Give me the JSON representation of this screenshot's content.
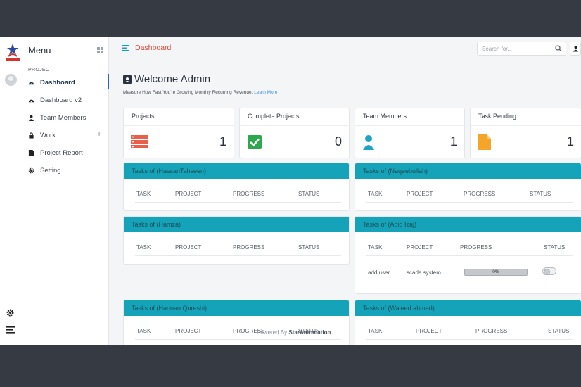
{
  "sidebar": {
    "menu_title": "Menu",
    "section_label": "PROJECT",
    "items": [
      {
        "label": "Dashboard",
        "icon": "dashboard-icon"
      },
      {
        "label": "Dashboard v2",
        "icon": "dashboard-icon"
      },
      {
        "label": "Team Members",
        "icon": "user-icon"
      },
      {
        "label": "Work",
        "icon": "lock-icon",
        "expand": "+"
      },
      {
        "label": "Project Report",
        "icon": "report-icon"
      },
      {
        "label": "Setting",
        "icon": "gear-icon"
      }
    ]
  },
  "topbar": {
    "title": "Dashboard",
    "search_placeholder": "Search for..."
  },
  "main": {
    "welcome": "Welcome Admin",
    "subtitle": "Measure How Fast You're Growing Monthly Recurring Revenue.",
    "learn_more": "Learn More"
  },
  "stats": [
    {
      "label": "Projects",
      "value": "1",
      "icon": "server-icon",
      "color": "#e8604c"
    },
    {
      "label": "Complete Projects",
      "value": "0",
      "icon": "check-icon",
      "color": "#2ea84f"
    },
    {
      "label": "Team Members",
      "value": "1",
      "icon": "user-icon",
      "color": "#1ba7c4"
    },
    {
      "label": "Task Pending",
      "value": "1",
      "icon": "file-icon",
      "color": "#f4a52a"
    }
  ],
  "task_columns": [
    "TASK",
    "PROJECT",
    "PROGRESS",
    "STATUS"
  ],
  "task_cards": [
    {
      "title": "Tasks of (HassanTahseen)"
    },
    {
      "title": "Tasks of (Naqeebullah)"
    },
    {
      "title": "Tasks of (Hamza)"
    },
    {
      "title": "Tasks of (Abid Izaj)",
      "rows": [
        {
          "task": "add user",
          "project": "scada system",
          "progress": "0%",
          "progress_value": 0
        }
      ]
    },
    {
      "title": "Tasks of (Hannan Qureshi)"
    },
    {
      "title": "Tasks of (Waleed ahmad)"
    }
  ],
  "footer": {
    "prefix": "Powered By",
    "brand": "StarAutomation"
  },
  "colors": {
    "accent": "#14a3b8",
    "header_title": "#e04a3a",
    "active_bar": "#2c62c5"
  }
}
